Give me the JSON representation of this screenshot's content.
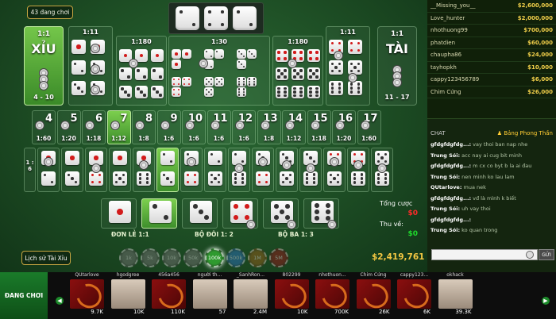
{
  "lobby": {
    "players_label": "43 đang chơi"
  },
  "big_bets": {
    "xiu": {
      "odds": "1:1",
      "label": "XỈU",
      "range": "4 - 10"
    },
    "tai": {
      "odds": "1:1",
      "label": "TÀI",
      "range": "11 - 17"
    }
  },
  "combo_odds": {
    "pair_left": "1:11",
    "triple_left": "1:180",
    "any_triple": "1:30",
    "triple_right": "1:180",
    "pair_right": "1:11"
  },
  "totals_row": [
    {
      "num": "4",
      "odds": "1:60"
    },
    {
      "num": "5",
      "odds": "1:20"
    },
    {
      "num": "6",
      "odds": "1:18"
    },
    {
      "num": "7",
      "odds": "1:12"
    },
    {
      "num": "8",
      "odds": "1:8"
    },
    {
      "num": "9",
      "odds": "1:6"
    },
    {
      "num": "10",
      "odds": "1:6"
    },
    {
      "num": "11",
      "odds": "1:6"
    },
    {
      "num": "12",
      "odds": "1:6"
    },
    {
      "num": "13",
      "odds": "1:8"
    },
    {
      "num": "14",
      "odds": "1:12"
    },
    {
      "num": "15",
      "odds": "1:18"
    },
    {
      "num": "16",
      "odds": "1:20"
    },
    {
      "num": "17",
      "odds": "1:60"
    }
  ],
  "two_dice_odds": "1 : 6",
  "singles": {
    "single": "ĐƠN LẺ 1:1",
    "double": "BỘ ĐÔI 1: 2",
    "triple": "BỘ BA 1: 3"
  },
  "summary": {
    "total_bet_label": "Tổng cược",
    "total_bet": "$0",
    "win_label": "Thu về:",
    "win": "$0"
  },
  "history_button": "Lịch sử Tài Xỉu",
  "chips": [
    "1k",
    "5k",
    "10k",
    "50k",
    "100k",
    "500k",
    "1M",
    "5M"
  ],
  "selected_chip": "100k",
  "balance": "$2,419,761",
  "leaderboard": [
    {
      "name": "__Missing_you__",
      "amount": "$2,600,000"
    },
    {
      "name": "Love_hunter",
      "amount": "$2,000,000"
    },
    {
      "name": "nhothuong99",
      "amount": "$700,000"
    },
    {
      "name": "phatdien",
      "amount": "$60,000"
    },
    {
      "name": "chaupha86",
      "amount": "$24,000"
    },
    {
      "name": "tayhopkh",
      "amount": "$10,000"
    },
    {
      "name": "cappy123456789",
      "amount": "$6,000"
    },
    {
      "name": "Chim Cứng",
      "amount": "$26,000"
    }
  ],
  "chat": {
    "title": "CHAT",
    "admin": "Bảng Phong Thần",
    "messages": [
      {
        "user": "gfdgfdgfdg...:",
        "text": "vay thoi ban nap nhe"
      },
      {
        "user": "Trung Sói:",
        "text": "acc nay ai cug bit minh"
      },
      {
        "user": "gfdgfdgfdg...:",
        "text": "m cx co byt b la ai đau"
      },
      {
        "user": "Trung Sói:",
        "text": "nen minh ko lau lam"
      },
      {
        "user": "QUtarlove:",
        "text": "mua nek"
      },
      {
        "user": "gfdgfdgfdg...:",
        "text": "vđ là mình k biết"
      },
      {
        "user": "Trung Sói:",
        "text": "uh vay thoi"
      },
      {
        "user": "gfdgfdgfdg...:",
        "text": ""
      },
      {
        "user": "Trung Sói:",
        "text": "ko quan trong"
      }
    ],
    "send_label": "GỬI"
  },
  "bottom": {
    "tab_label": "ĐANG CHƠI",
    "players": [
      {
        "name": "QUtarlove",
        "cash": "9.7K",
        "pic": "dragon"
      },
      {
        "name": "hgodgree",
        "cash": "10K",
        "pic": "photo"
      },
      {
        "name": "456a456",
        "cash": "110K",
        "pic": "dragon"
      },
      {
        "name": "người th...",
        "cash": "57",
        "pic": "photo"
      },
      {
        "name": "_SanhRon...",
        "cash": "2.4M",
        "pic": "photo"
      },
      {
        "name": "802299",
        "cash": "10K",
        "pic": "dragon"
      },
      {
        "name": "nhothuon...",
        "cash": "700K",
        "pic": "dragon"
      },
      {
        "name": "Chim Cứng",
        "cash": "26K",
        "pic": "dragon"
      },
      {
        "name": "cappy123...",
        "cash": "6K",
        "pic": "dragon"
      },
      {
        "name": "okhack",
        "cash": "39.3K",
        "pic": "photo"
      }
    ]
  },
  "colors": {
    "table_green": "#2c6a35",
    "highlight": "#7ccf4e",
    "gold": "#f4c742",
    "loss_red": "#ff2a2a",
    "win_green": "#1fd82c"
  }
}
